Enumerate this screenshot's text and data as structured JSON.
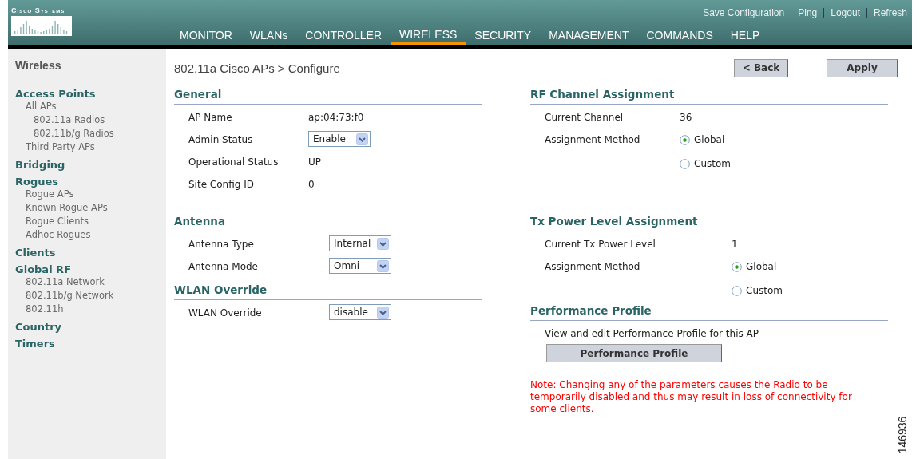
{
  "header": {
    "logo_text": "Cisco Systems",
    "top_links": [
      "Save Configuration",
      "Ping",
      "Logout",
      "Refresh"
    ],
    "nav": [
      {
        "label": "MONITOR",
        "selected": false
      },
      {
        "label": "WLANs",
        "selected": false
      },
      {
        "label": "CONTROLLER",
        "selected": false
      },
      {
        "label": "WIRELESS",
        "selected": true
      },
      {
        "label": "SECURITY",
        "selected": false
      },
      {
        "label": "MANAGEMENT",
        "selected": false
      },
      {
        "label": "COMMANDS",
        "selected": false
      },
      {
        "label": "HELP",
        "selected": false
      }
    ]
  },
  "sidebar": {
    "title": "Wireless",
    "groups": [
      {
        "label": "Access Points",
        "children": [
          {
            "label": "All APs",
            "children": [
              {
                "label": "802.11a Radios"
              },
              {
                "label": "802.11b/g Radios"
              }
            ]
          },
          {
            "label": "Third Party APs"
          }
        ]
      },
      {
        "label": "Bridging"
      },
      {
        "label": "Rogues",
        "children": [
          {
            "label": "Rogue APs"
          },
          {
            "label": "Known Rogue APs"
          },
          {
            "label": "Rogue Clients"
          },
          {
            "label": "Adhoc Rogues"
          }
        ]
      },
      {
        "label": "Clients"
      },
      {
        "label": "Global RF",
        "children": [
          {
            "label": "802.11a Network"
          },
          {
            "label": "802.11b/g Network"
          },
          {
            "label": "802.11h"
          }
        ]
      },
      {
        "label": "Country"
      },
      {
        "label": "Timers"
      }
    ]
  },
  "page_title": "802.11a Cisco APs > Configure",
  "buttons": [
    "< Back",
    "Apply"
  ],
  "left_sections": [
    {
      "title": "General",
      "rows": [
        {
          "kind": "text",
          "label": "AP Name",
          "value": "ap:04:73:f0"
        },
        {
          "kind": "select",
          "label": "Admin Status",
          "value": "Enable"
        },
        {
          "kind": "text",
          "label": "Operational Status",
          "value": "UP"
        },
        {
          "kind": "text",
          "label": "Site Config ID",
          "value": "0"
        }
      ]
    },
    {
      "title": "Antenna",
      "rows": [
        {
          "kind": "select",
          "label": "Antenna Type",
          "value": "Internal"
        },
        {
          "kind": "select",
          "label": "Antenna Mode",
          "value": "Omni"
        }
      ]
    },
    {
      "title": "WLAN Override",
      "rows": [
        {
          "kind": "select",
          "label": "WLAN Override",
          "value": "disable"
        }
      ]
    }
  ],
  "right_sections": [
    {
      "title": "RF Channel Assignment",
      "rows": [
        {
          "kind": "text",
          "label": "Current Channel",
          "value": "36"
        },
        {
          "kind": "radio",
          "label": "Assignment Method",
          "options": [
            {
              "label": "Global",
              "selected": true
            },
            {
              "label": "Custom",
              "selected": false
            }
          ]
        }
      ]
    },
    {
      "title": "Tx Power Level Assignment",
      "rows": [
        {
          "kind": "text",
          "label": "Current Tx Power Level",
          "value": "1"
        },
        {
          "kind": "radio",
          "label": "Assignment Method",
          "options": [
            {
              "label": "Global",
              "selected": true
            },
            {
              "label": "Custom",
              "selected": false
            }
          ]
        }
      ]
    },
    {
      "title": "Performance Profile",
      "rows": [
        {
          "kind": "note",
          "label": "View and edit Performance Profile for this AP"
        },
        {
          "kind": "button",
          "label": "Performance Profile"
        }
      ]
    }
  ],
  "note": "Note: Changing any of the parameters causes the Radio to be temporarily disabled and thus may result in loss of connectivity for some clients.",
  "figure_id": "146936"
}
